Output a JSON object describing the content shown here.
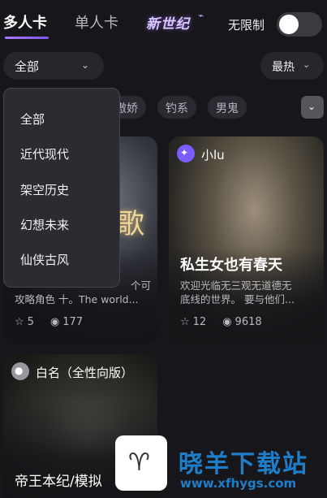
{
  "header": {
    "tabs": [
      {
        "label": "多人卡",
        "active": true
      },
      {
        "label": "单人卡",
        "active": false
      }
    ],
    "logo_text": "新世纪",
    "no_limit_label": "无限制",
    "no_limit_on": false
  },
  "filters": {
    "category_selected": "全部",
    "sort_selected": "最热",
    "chips": [
      "傲娇",
      "钓系",
      "男鬼"
    ]
  },
  "dropdown": {
    "options": [
      "全部",
      "近代现代",
      "架空历史",
      "幻想未来",
      "仙侠古风"
    ]
  },
  "cards": [
    {
      "author": "",
      "title": "",
      "desc_line1": "个可",
      "desc_line2": "攻略角色 十。The world...",
      "likes": "5",
      "views": "177",
      "art_text": "歌"
    },
    {
      "author": "小lu",
      "title": "私生女也有春天",
      "desc_line1": "欢迎光临无三观无道德无",
      "desc_line2": "底线的世界。 要与他们...",
      "likes": "12",
      "views": "9618"
    },
    {
      "author": "白名（全性向版）",
      "title": "帝王本纪/模拟"
    }
  ],
  "icons": {
    "chevron": "chevron-down-icon",
    "star": "star-icon",
    "eye": "eye-icon"
  },
  "watermark": {
    "text": "晓羊下载站",
    "url": "www.xfhygs.com"
  }
}
